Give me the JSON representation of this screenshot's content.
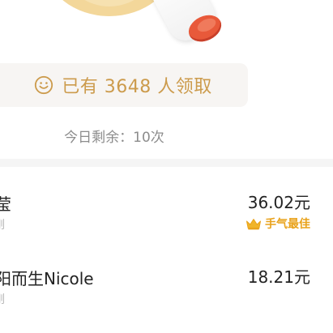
{
  "summary": {
    "claimed_text": "已有 3648 人领取",
    "remaining_text": "今日剩余：10次"
  },
  "records": [
    {
      "name": "莹",
      "sub": "刚",
      "amount": "36.02元",
      "badge": "手气最佳"
    },
    {
      "name": "阳而生Nicole",
      "sub": "刚",
      "amount": "18.21元"
    }
  ],
  "icons": {
    "claimed": "smile-icon",
    "best": "crown-icon",
    "illustration": "bottle-illustration"
  },
  "colors": {
    "accent_gold": "#cc9b4c",
    "best_badge": "#e9a21b",
    "bottle_cap": "#e8593a",
    "blob": "#f3d79a"
  }
}
